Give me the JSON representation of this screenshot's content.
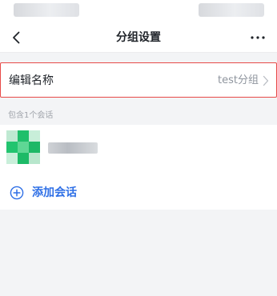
{
  "status_bar": {},
  "nav": {
    "title": "分组设置",
    "back_icon": "chevron-left-icon",
    "more_icon": "more-dots-icon"
  },
  "group_name_row": {
    "label": "编辑名称",
    "value": "test分组",
    "arrow_icon": "chevron-right-icon"
  },
  "conversations": {
    "caption": "包含1个会话",
    "items": [
      {
        "avatar": "avatar-pixelated",
        "name": ""
      }
    ]
  },
  "add_conversation": {
    "label": "添加会话",
    "icon": "plus-circle-icon"
  },
  "colors": {
    "accent": "#2e6fe6",
    "highlight_border": "#e84a48",
    "avatar_green": "#1fbf6b",
    "background": "#f3f4f6"
  }
}
